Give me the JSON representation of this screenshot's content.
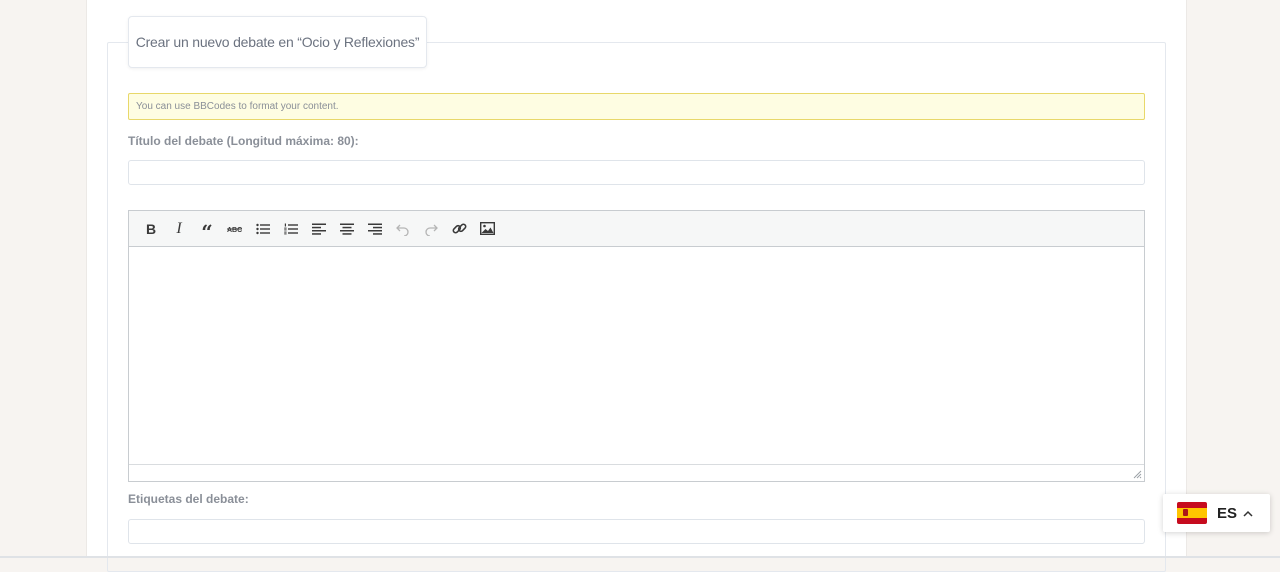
{
  "form": {
    "legend": "Crear un nuevo debate en “Ocio y Reflexiones”",
    "notice": "You can use BBCodes to format your content.",
    "title_label": "Título del debate (Longitud máxima: 80):",
    "title_value": "",
    "tags_label": "Etiquetas del debate:",
    "tags_value": ""
  },
  "editor": {
    "toolbar": [
      {
        "name": "bold",
        "icon": "bold-icon"
      },
      {
        "name": "italic",
        "icon": "italic-icon"
      },
      {
        "name": "blockquote",
        "icon": "quote-icon"
      },
      {
        "name": "strikethrough",
        "icon": "strikethrough-icon"
      },
      {
        "name": "bullet-list",
        "icon": "bullet-list-icon"
      },
      {
        "name": "numbered-list",
        "icon": "numbered-list-icon"
      },
      {
        "name": "align-left",
        "icon": "align-left-icon"
      },
      {
        "name": "align-center",
        "icon": "align-center-icon"
      },
      {
        "name": "align-right",
        "icon": "align-right-icon"
      },
      {
        "name": "undo",
        "icon": "undo-icon",
        "disabled": true
      },
      {
        "name": "redo",
        "icon": "redo-icon",
        "disabled": true
      },
      {
        "name": "link",
        "icon": "link-icon"
      },
      {
        "name": "image",
        "icon": "image-icon"
      }
    ]
  },
  "language_switcher": {
    "code": "ES",
    "flag": "spain-flag-icon",
    "flag_colors": {
      "red": "#c60b1e",
      "yellow": "#ffc400"
    }
  },
  "colors": {
    "notice_bg": "#fefde2",
    "notice_border": "#e8d86a",
    "label_text": "#8a8f98"
  }
}
